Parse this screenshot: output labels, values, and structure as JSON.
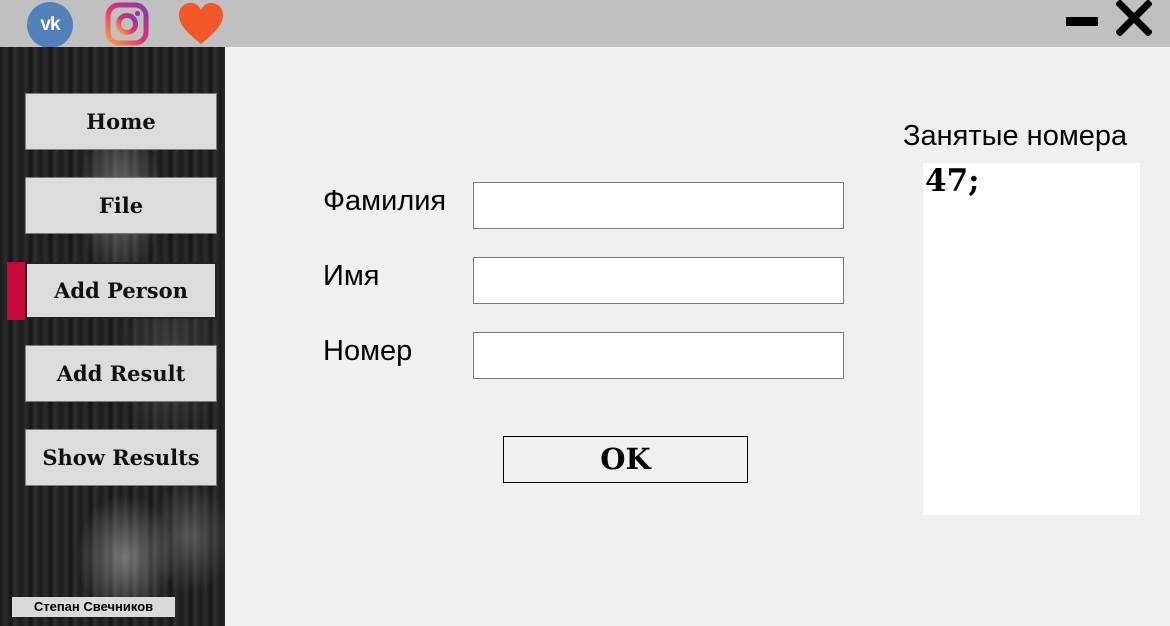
{
  "titlebar": {
    "icons": [
      "vk-icon",
      "instagram-icon",
      "heart-icon",
      "minimize-icon",
      "close-icon"
    ],
    "vk_text": "vk"
  },
  "sidebar": {
    "items": [
      {
        "label": "Home"
      },
      {
        "label": "File"
      },
      {
        "label": "Add Person"
      },
      {
        "label": "Add Result"
      },
      {
        "label": "Show Results"
      }
    ],
    "active_index": 2,
    "active_color": "#c8083c",
    "author": "Степан Свечников"
  },
  "form": {
    "surname_label": "Фамилия",
    "surname_value": "",
    "name_label": "Имя",
    "name_value": "",
    "number_label": "Номер",
    "number_value": "",
    "ok_label": "OK"
  },
  "occupied": {
    "title": "Занятые номера",
    "text": "47;"
  }
}
